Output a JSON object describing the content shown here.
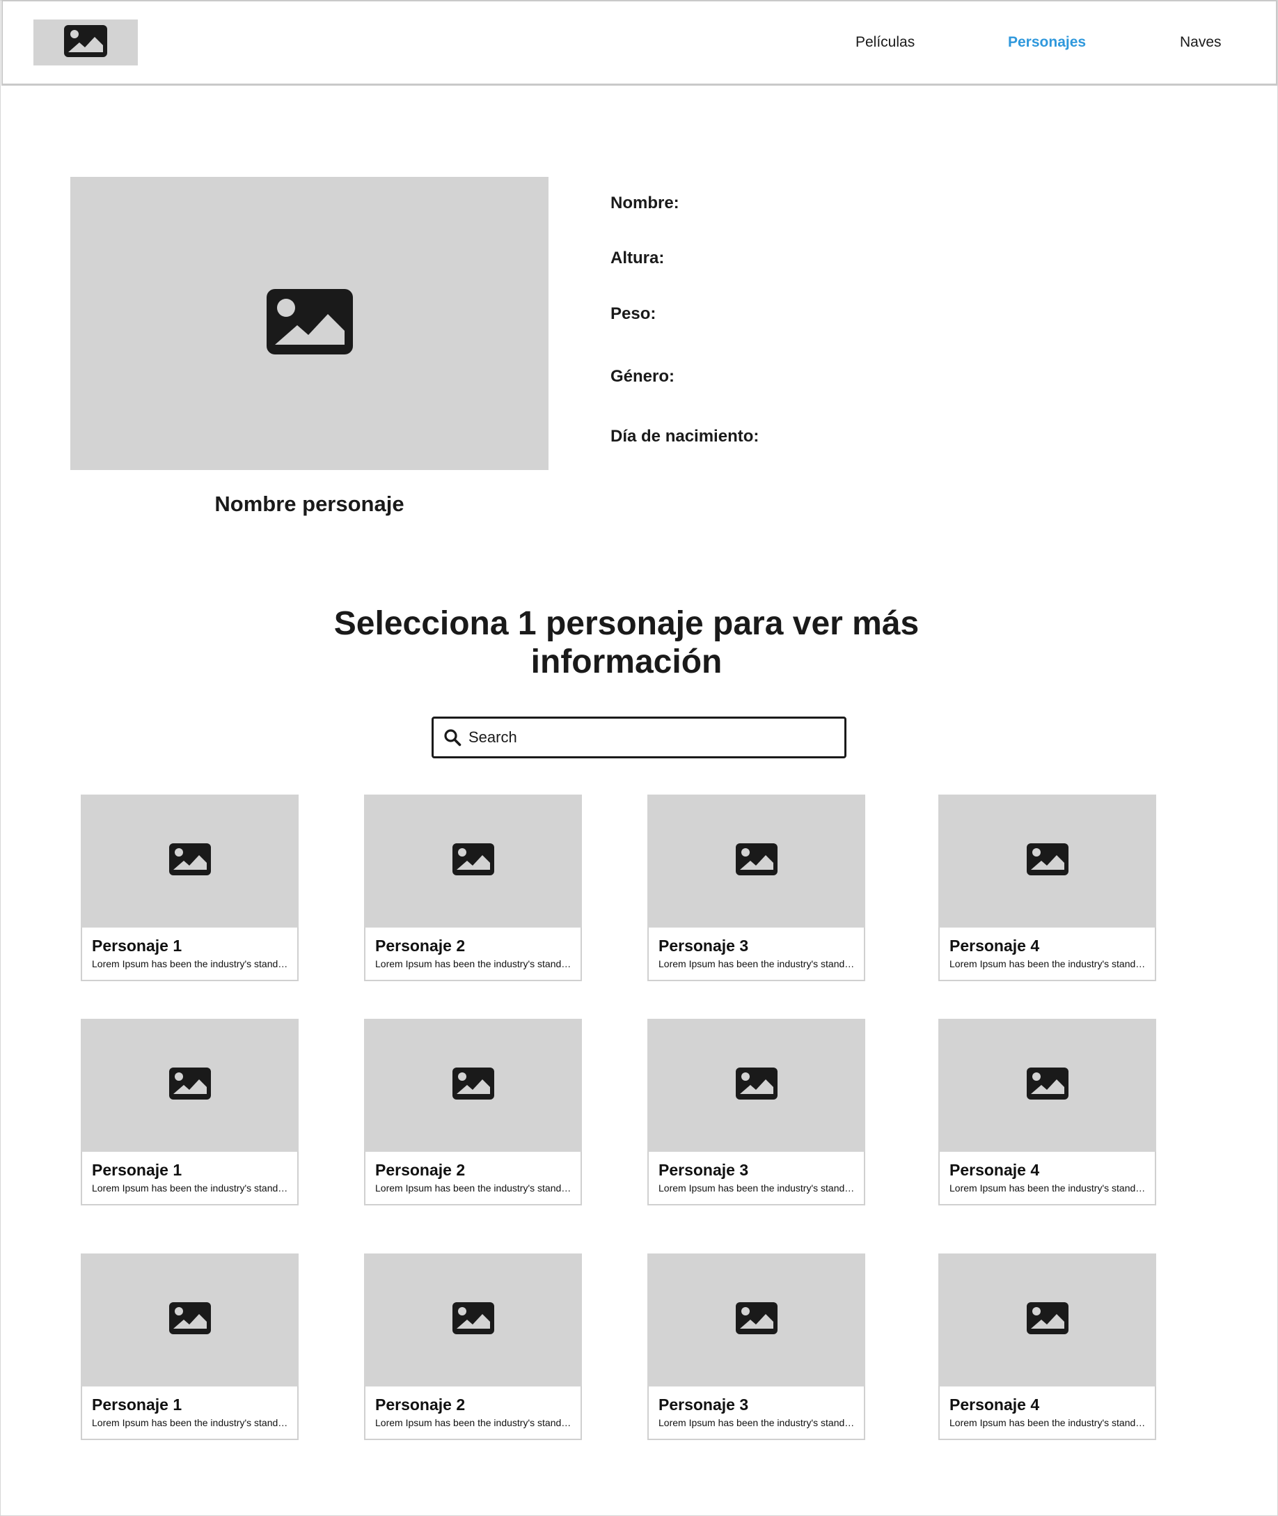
{
  "nav": {
    "items": [
      {
        "label": "Películas",
        "active": false
      },
      {
        "label": "Personajes",
        "active": true
      },
      {
        "label": "Naves",
        "active": false
      }
    ],
    "active_color": "#2f98dc"
  },
  "detail": {
    "image_icon": "image-icon",
    "name": "Nombre personaje",
    "fields": [
      {
        "label": "Nombre:"
      },
      {
        "label": "Altura:"
      },
      {
        "label": "Peso:"
      },
      {
        "label": "Género:"
      },
      {
        "label": "Día de nacimiento:"
      }
    ]
  },
  "section": {
    "title": "Selecciona 1 personaje para ver más información"
  },
  "search": {
    "placeholder": "Search",
    "icon": "search-icon"
  },
  "cards": {
    "rows": [
      [
        {
          "title": "Personaje 1",
          "desc": "Lorem Ipsum has been the industry's standard dummy text"
        },
        {
          "title": "Personaje 2",
          "desc": "Lorem Ipsum has been the industry's standard dummy text"
        },
        {
          "title": "Personaje 3",
          "desc": "Lorem Ipsum has been the industry's standard dummy text"
        },
        {
          "title": "Personaje 4",
          "desc": "Lorem Ipsum has been the industry's standard dummy text"
        }
      ],
      [
        {
          "title": "Personaje 1",
          "desc": "Lorem Ipsum has been the industry's standard dummy text"
        },
        {
          "title": "Personaje 2",
          "desc": "Lorem Ipsum has been the industry's standard dummy text"
        },
        {
          "title": "Personaje 3",
          "desc": "Lorem Ipsum has been the industry's standard dummy text"
        },
        {
          "title": "Personaje 4",
          "desc": "Lorem Ipsum has been the industry's standard dummy text"
        }
      ],
      [
        {
          "title": "Personaje 1",
          "desc": "Lorem Ipsum has been the industry's standard dummy text"
        },
        {
          "title": "Personaje 2",
          "desc": "Lorem Ipsum has been the industry's standard dummy text"
        },
        {
          "title": "Personaje 3",
          "desc": "Lorem Ipsum has been the industry's standard dummy text"
        },
        {
          "title": "Personaje 4",
          "desc": "Lorem Ipsum has been the industry's standard dummy text"
        }
      ]
    ]
  }
}
